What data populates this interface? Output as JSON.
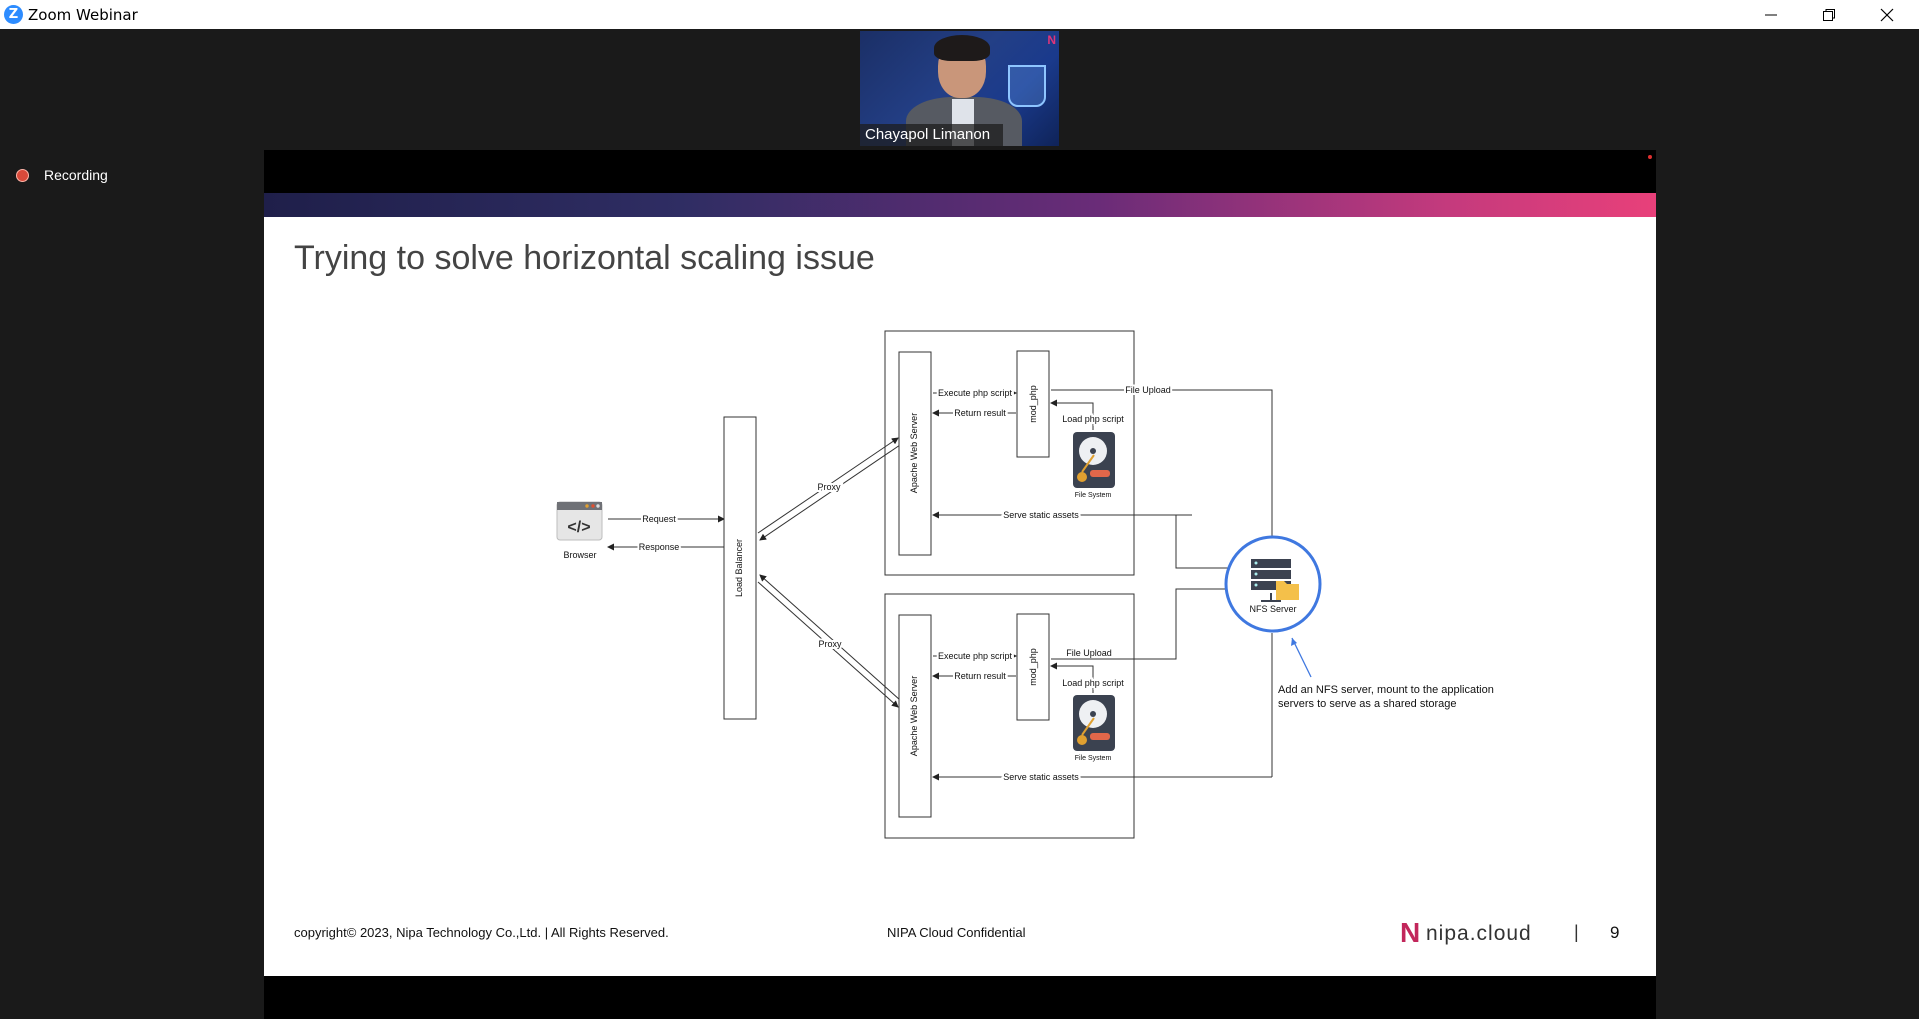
{
  "window": {
    "title": "Zoom Webinar",
    "app_icon_letter": "Z",
    "controls": [
      "minimize",
      "restore",
      "close"
    ]
  },
  "video": {
    "participant_name": "Chayapol Limanon",
    "badge": "N"
  },
  "status": {
    "recording_label": "Recording"
  },
  "slide": {
    "title": "Trying to solve horizontal scaling issue",
    "diagram": {
      "browser": {
        "icon_text": "</>",
        "label": "Browser"
      },
      "arrows": {
        "request": "Request",
        "response": "Response",
        "proxy_top": "Proxy",
        "proxy_bottom": "Proxy"
      },
      "load_balancer": "Load Balancer",
      "top_server": {
        "web_server": "Apache Web Server",
        "mod": "mod_php",
        "execute": "Execute php script",
        "return": "Return result",
        "load": "Load php script",
        "fs": "File System",
        "file_upload": "File Upload",
        "static": "Serve static assets"
      },
      "bottom_server": {
        "web_server": "Apache Web Server",
        "mod": "mod_php",
        "execute": "Execute php script",
        "return": "Return result",
        "load": "Load php script",
        "fs": "File System",
        "file_upload": "File Upload",
        "static": "Serve static assets"
      },
      "nfs": {
        "label": "NFS Server",
        "note_line1": "Add an NFS server, mount to the application",
        "note_line2": "servers to serve as a shared storage"
      }
    },
    "footer": {
      "copyright": "copyright© 2023, Nipa Technology Co.,Ltd. | All Rights Reserved.",
      "confidential": "NIPA Cloud Confidential",
      "logo_mark": "N",
      "logo_text": "nipa.cloud",
      "separator": "|",
      "page_number": "9"
    }
  },
  "colors": {
    "accent_blue": "#2d8cff",
    "nfs_ring": "#3f78e0",
    "brand_pink": "#c2265b"
  }
}
